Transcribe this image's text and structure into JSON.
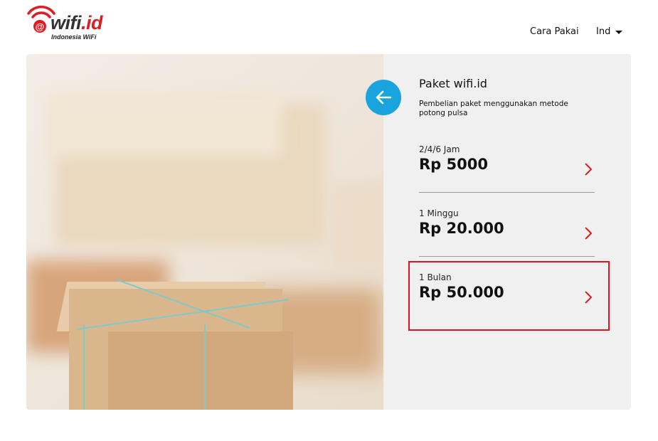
{
  "header": {
    "logo_word_main": "wifi",
    "logo_word_dot": ".",
    "logo_word_id": "id",
    "logo_at": "@",
    "logo_subtitle": "Indonesia WiFi",
    "nav_cara_pakai": "Cara Pakai",
    "nav_language": "Ind"
  },
  "panel": {
    "title": "Paket wifi.id",
    "description": "Pembelian paket menggunakan metode potong pulsa",
    "packages": [
      {
        "duration": "2/4/6 Jam",
        "price": "Rp 5000"
      },
      {
        "duration": "1 Minggu",
        "price": "Rp 20.000"
      },
      {
        "duration": "1 Bulan",
        "price": "Rp 50.000"
      }
    ]
  },
  "colors": {
    "brand_red": "#e11b22",
    "back_button_blue": "#1aa4dd",
    "highlight_red": "#e0141e",
    "panel_bg": "#f0f0f0"
  },
  "icons": {
    "back": "arrow-left-icon",
    "chevron": "chevron-right-icon",
    "language_dropdown": "caret-down-icon",
    "logo_signal": "wifi-signal-icon"
  }
}
